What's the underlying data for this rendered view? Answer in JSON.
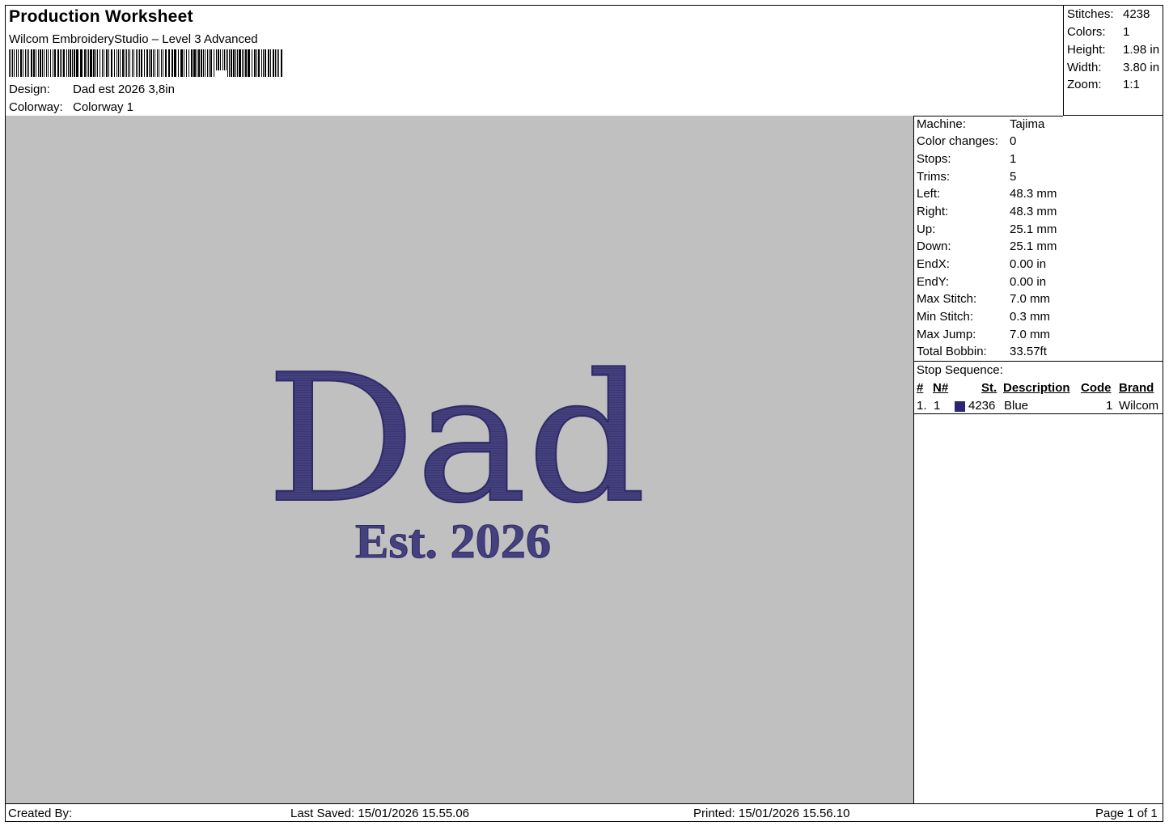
{
  "header": {
    "title": "Production Worksheet",
    "app": "Wilcom EmbroideryStudio – Level 3 Advanced",
    "design_label": "Design:",
    "design_value": "Dad est 2026 3,8in",
    "colorway_label": "Colorway:",
    "colorway_value": "Colorway 1"
  },
  "stats": [
    {
      "label": "Stitches:",
      "value": "4238"
    },
    {
      "label": "Colors:",
      "value": "1"
    },
    {
      "label": "Height:",
      "value": "1.98 in"
    },
    {
      "label": "Width:",
      "value": "3.80 in"
    },
    {
      "label": "Zoom:",
      "value": "1:1"
    }
  ],
  "info": [
    {
      "label": "Machine:",
      "value": "Tajima"
    },
    {
      "label": "Color changes:",
      "value": "0"
    },
    {
      "label": "Stops:",
      "value": "1"
    },
    {
      "label": "Trims:",
      "value": "5"
    },
    {
      "label": "Left:",
      "value": "48.3 mm"
    },
    {
      "label": "Right:",
      "value": "48.3 mm"
    },
    {
      "label": "Up:",
      "value": "25.1 mm"
    },
    {
      "label": "Down:",
      "value": "25.1 mm"
    },
    {
      "label": "EndX:",
      "value": "0.00 in"
    },
    {
      "label": "EndY:",
      "value": "0.00 in"
    },
    {
      "label": "Max Stitch:",
      "value": "7.0 mm"
    },
    {
      "label": "Min Stitch:",
      "value": "0.3 mm"
    },
    {
      "label": "Max Jump:",
      "value": "7.0 mm"
    },
    {
      "label": "Total Bobbin:",
      "value": "33.57ft"
    }
  ],
  "stop_sequence": {
    "title": "Stop Sequence:",
    "columns": {
      "num": "#",
      "n": "N#",
      "st": "St.",
      "description": "Description",
      "code": "Code",
      "brand": "Brand"
    },
    "rows": [
      {
        "num": "1.",
        "n": "1",
        "st": "4236",
        "description": "Blue",
        "code": "1",
        "brand": "Wilcom",
        "color": "#2b2578"
      }
    ]
  },
  "design_text": {
    "main": "Dad",
    "sub": "Est. 2026",
    "thread_color": "#45417f"
  },
  "footer": {
    "created_by": "Created By:",
    "last_saved": "Last Saved: 15/01/2026 15.55.06",
    "printed": "Printed: 15/01/2026 15.56.10",
    "page": "Page 1 of 1"
  }
}
